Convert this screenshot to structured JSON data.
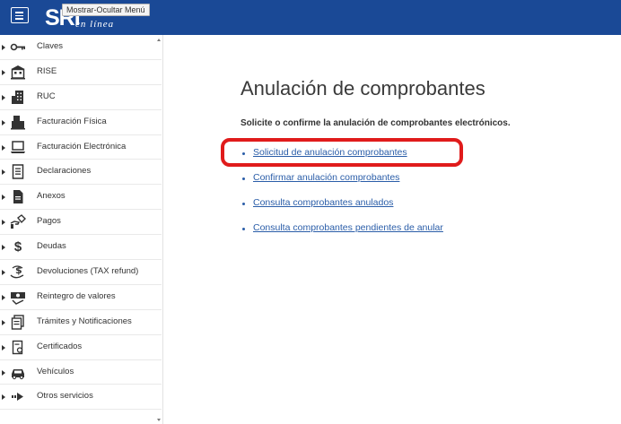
{
  "header": {
    "logo_text": "SRI",
    "logo_subtext": "en línea",
    "tooltip": "Mostrar-Ocultar Menú",
    "colors": {
      "bar": "#1a4996",
      "text": "#ffffff"
    }
  },
  "sidebar": {
    "items": [
      {
        "label": "Claves",
        "icon": "key-icon"
      },
      {
        "label": "RISE",
        "icon": "building-icon"
      },
      {
        "label": "RUC",
        "icon": "office-icon"
      },
      {
        "label": "Facturación Física",
        "icon": "printer-icon"
      },
      {
        "label": "Facturación Electrónica",
        "icon": "laptop-icon"
      },
      {
        "label": "Declaraciones",
        "icon": "document-icon"
      },
      {
        "label": "Anexos",
        "icon": "file-icon"
      },
      {
        "label": "Pagos",
        "icon": "hand-tag-icon"
      },
      {
        "label": "Deudas",
        "icon": "dollar-icon"
      },
      {
        "label": "Devoluciones (TAX refund)",
        "icon": "refund-icon"
      },
      {
        "label": "Reintegro de valores",
        "icon": "money-icon"
      },
      {
        "label": "Trámites y Notificaciones",
        "icon": "forms-icon"
      },
      {
        "label": "Certificados",
        "icon": "certificate-icon"
      },
      {
        "label": "Vehículos",
        "icon": "car-icon"
      },
      {
        "label": "Otros servicios",
        "icon": "arrow-right-icon"
      }
    ]
  },
  "main": {
    "title": "Anulación de comprobantes",
    "subtitle": "Solicite o confirme la anulación de comprobantes electrónicos.",
    "links": [
      {
        "label": "Solicitud de anulación comprobantes"
      },
      {
        "label": "Confirmar anulación comprobantes"
      },
      {
        "label": "Consulta comprobantes anulados"
      },
      {
        "label": "Consulta comprobantes pendientes de anular"
      }
    ],
    "link_color": "#2a5da8",
    "highlight_color": "#e01b1b"
  }
}
